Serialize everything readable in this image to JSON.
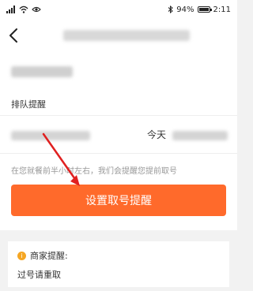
{
  "status_bar": {
    "battery": "94%",
    "battery_level": 0.94,
    "time": "2:11",
    "icons": [
      "signal-icon",
      "wifi-icon",
      "eye-icon",
      "bluetooth-icon",
      "battery-icon"
    ]
  },
  "nav": {
    "back_icon": "chevron-left-icon"
  },
  "queue": {
    "section_title": "排队提醒",
    "today_label": "今天",
    "hint": "在您就餐前半小时左右，我们会提醒您提前取号",
    "remind_button": "设置取号提醒"
  },
  "notice": {
    "title": "商家提醒:",
    "content": "过号请重取",
    "icon": "info-icon"
  },
  "colors": {
    "accent": "#ff6a2b",
    "hint": "#999999",
    "annotation_arrow": "#e02020"
  }
}
